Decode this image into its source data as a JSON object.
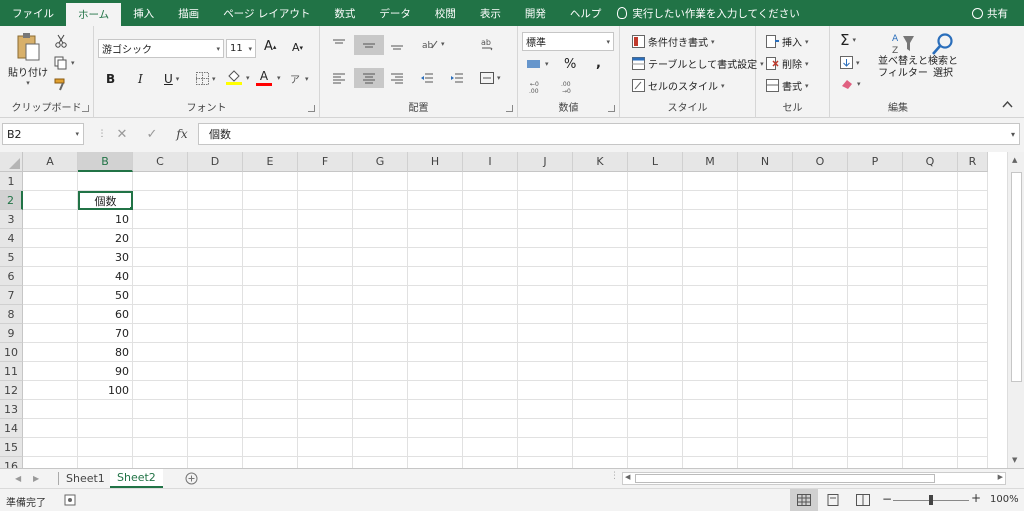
{
  "tabs": [
    "ファイル",
    "ホーム",
    "挿入",
    "描画",
    "ページ レイアウト",
    "数式",
    "データ",
    "校閲",
    "表示",
    "開発",
    "ヘルプ"
  ],
  "active_tab_index": 1,
  "tell_me": "実行したい作業を入力してください",
  "share": "共有",
  "ribbon": {
    "clipboard": {
      "label": "クリップボード",
      "paste": "貼り付け"
    },
    "font": {
      "label": "フォント",
      "name": "游ゴシック",
      "size": "11",
      "bold": "B",
      "italic": "I",
      "underline": "U",
      "grow": "A",
      "shrink": "A",
      "font_color": "A"
    },
    "alignment": {
      "label": "配置"
    },
    "number": {
      "label": "数値",
      "format": "標準",
      "percent": "%",
      "comma": ","
    },
    "styles": {
      "label": "スタイル",
      "conditional": "条件付き書式",
      "table": "テーブルとして書式設定",
      "cell_style": "セルのスタイル"
    },
    "cells": {
      "label": "セル",
      "insert": "挿入",
      "delete": "削除",
      "format": "書式"
    },
    "editing": {
      "label": "編集",
      "sum": "Σ",
      "sort_line1": "並べ替えと",
      "sort_line2": "フィルター",
      "find_line1": "検索と",
      "find_line2": "選択"
    }
  },
  "formula_bar": {
    "name_box": "B2",
    "cancel": "✕",
    "enter": "✓",
    "fx": "fx",
    "content": "個数"
  },
  "columns": [
    "A",
    "B",
    "C",
    "D",
    "E",
    "F",
    "G",
    "H",
    "I",
    "J",
    "K",
    "L",
    "M",
    "N",
    "O",
    "P",
    "Q",
    "R"
  ],
  "rows": [
    "1",
    "2",
    "3",
    "4",
    "5",
    "6",
    "7",
    "8",
    "9",
    "10",
    "11",
    "12",
    "13",
    "14",
    "15",
    "16"
  ],
  "cells": {
    "B2": "個数",
    "B3": "10",
    "B4": "20",
    "B5": "30",
    "B6": "40",
    "B7": "50",
    "B8": "60",
    "B9": "70",
    "B10": "80",
    "B11": "90",
    "B12": "100"
  },
  "selected_cell": "B2",
  "sheets": [
    "Sheet1",
    "Sheet2"
  ],
  "active_sheet_index": 1,
  "status": {
    "ready": "準備完了",
    "zoom": "100%",
    "zoom_level_fraction": 0.5
  },
  "colors": {
    "accent": "#217346",
    "highlight": "#ffff00",
    "font_red": "#ff0000"
  }
}
